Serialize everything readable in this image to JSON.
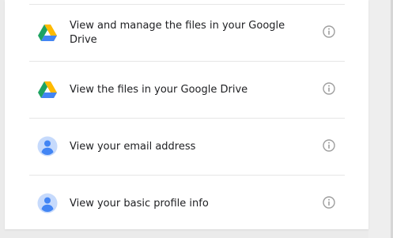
{
  "permissions": [
    {
      "label": "View and manage the files in your Google Drive",
      "icon": "google-drive-icon"
    },
    {
      "label": "View the files in your Google Drive",
      "icon": "google-drive-icon"
    },
    {
      "label": "View your email address",
      "icon": "account-icon"
    },
    {
      "label": "View your basic profile info",
      "icon": "account-icon"
    }
  ],
  "colors": {
    "drive_green": "#1ea362",
    "drive_yellow": "#ffba00",
    "drive_blue": "#4285f4",
    "account_bg": "#c6dafc",
    "account_fg": "#4285f4",
    "info_gray": "#9e9e9e"
  }
}
